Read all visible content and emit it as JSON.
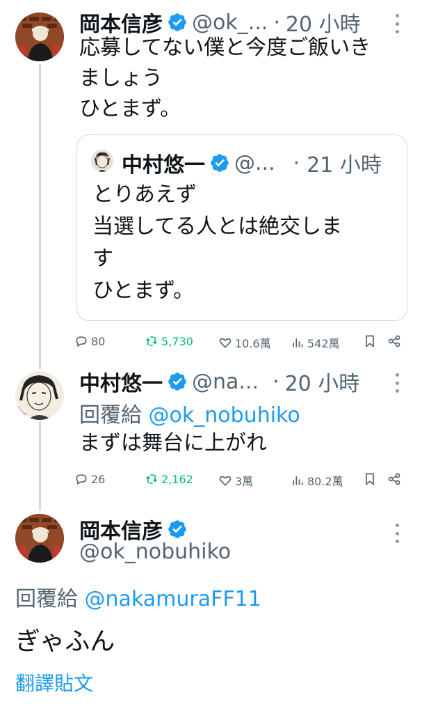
{
  "tweet1": {
    "name": "岡本信彦",
    "handle": "@ok_...",
    "separator": "·",
    "time": "20 小時",
    "text": "応募してない僕と今度ご飯いき\nましょう\nひとまず。",
    "quote": {
      "name": "中村悠一",
      "handle": "@...",
      "separator": "·",
      "time": "21 小時",
      "text": "とりあえず\n当選してる人とは絶交しま\nす\nひとまず。"
    },
    "actions": {
      "replies": "80",
      "retweets": "5,730",
      "likes": "10.6萬",
      "views": "542萬"
    }
  },
  "tweet2": {
    "name": "中村悠一",
    "handle": "@na...",
    "separator": "·",
    "time": "20 小時",
    "reply_prefix": "回覆給",
    "reply_mention": "@ok_nobuhiko",
    "text": "まずは舞台に上がれ",
    "actions": {
      "replies": "26",
      "retweets": "2,162",
      "likes": "3萬",
      "views": "80.2萬"
    }
  },
  "main_tweet": {
    "name": "岡本信彦",
    "handle": "@ok_nobuhiko",
    "reply_prefix": "回覆給",
    "reply_mention": "@nakamuraFF11",
    "text": "ぎゃふん",
    "translate_label": "翻譯貼文"
  },
  "colors": {
    "accent": "#1d9bf0",
    "secondary_text": "#536471",
    "retweet": "#00ba7c",
    "thread_line": "#cfd9de"
  },
  "icons": [
    "verified-badge-icon",
    "more-icon",
    "reply-icon",
    "retweet-icon",
    "like-icon",
    "views-icon",
    "bookmark-icon",
    "share-icon"
  ]
}
